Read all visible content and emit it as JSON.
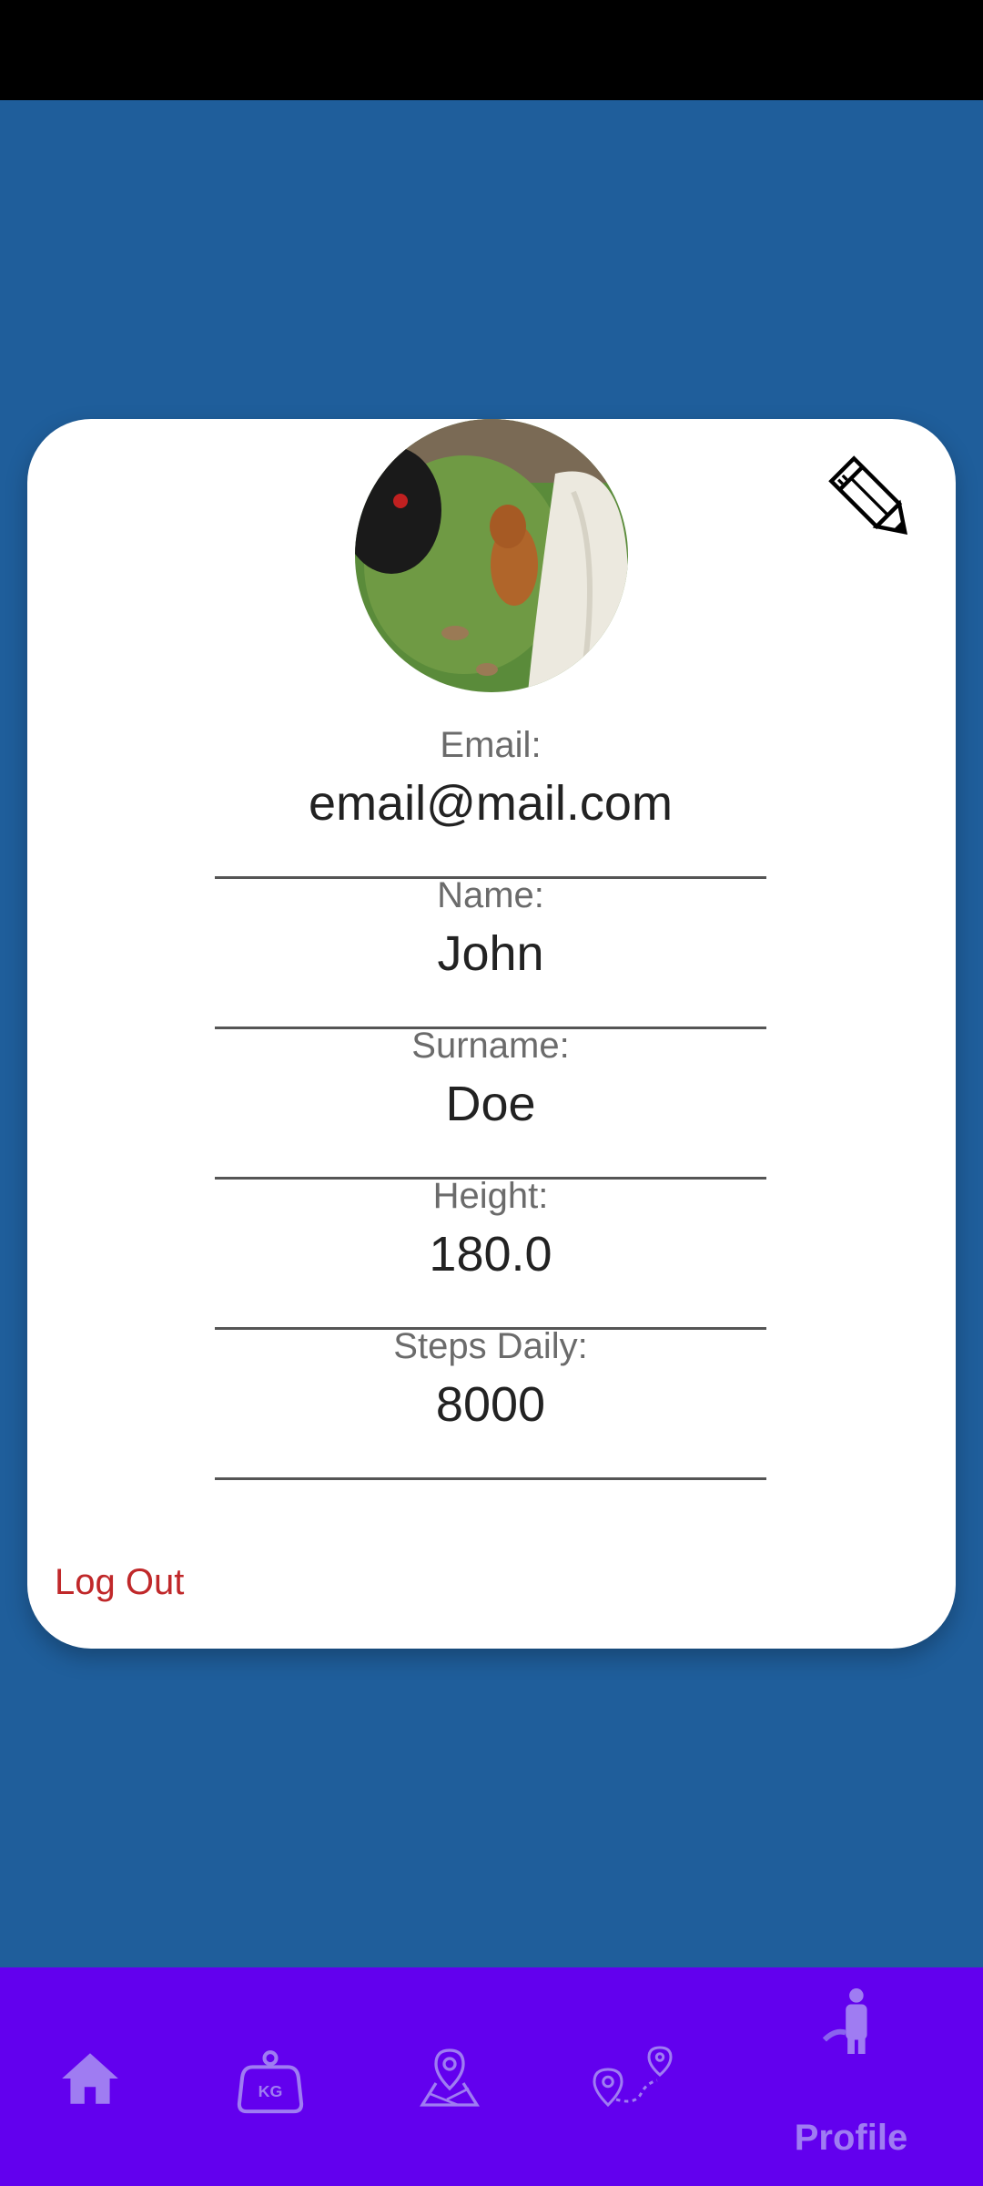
{
  "profile": {
    "email_label": "Email:",
    "email_value": "email@mail.com",
    "name_label": "Name:",
    "name_value": "John",
    "surname_label": "Surname:",
    "surname_value": "Doe",
    "height_label": "Height:",
    "height_value": "180.0",
    "steps_label": "Steps Daily:",
    "steps_value": "8000",
    "logout_label": "Log Out"
  },
  "icons": {
    "edit": "pencil-icon",
    "nav_home": "home-icon",
    "nav_weight": "weight-kg-icon",
    "nav_map": "map-pin-icon",
    "nav_routes": "route-icon",
    "nav_profile": "person-icon"
  },
  "nav": {
    "active_label": "Profile"
  },
  "colors": {
    "background": "#1f5e9b",
    "nav_bar": "#6200ee",
    "nav_icon": "#9f7cf2",
    "logout": "#c0282a"
  }
}
